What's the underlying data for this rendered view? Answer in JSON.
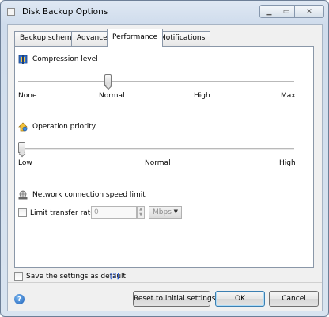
{
  "window": {
    "title": "Disk Backup Options"
  },
  "tabs": [
    {
      "label": "Backup scheme"
    },
    {
      "label": "Advanced"
    },
    {
      "label": "Performance",
      "active": true
    },
    {
      "label": "Notifications"
    }
  ],
  "compression": {
    "label": "Compression level",
    "ticks": [
      "None",
      "Normal",
      "High",
      "Max"
    ],
    "selected": "Normal"
  },
  "priority": {
    "label": "Operation priority",
    "ticks": [
      "Low",
      "Normal",
      "High"
    ],
    "selected": "Low"
  },
  "network": {
    "label": "Network connection speed limit",
    "limit_checkbox_label": "Limit transfer rate to:",
    "limit_checked": false,
    "rate_value": "0",
    "unit": "Mbps"
  },
  "footer": {
    "save_default_label": "Save the settings as default",
    "help_link": "[?]",
    "reset_label": "Reset to initial settings",
    "ok_label": "OK",
    "cancel_label": "Cancel"
  },
  "icons": {
    "title": "app-icon",
    "compression": "compression-icon",
    "priority": "priority-icon",
    "network": "network-icon",
    "help": "help-icon"
  }
}
